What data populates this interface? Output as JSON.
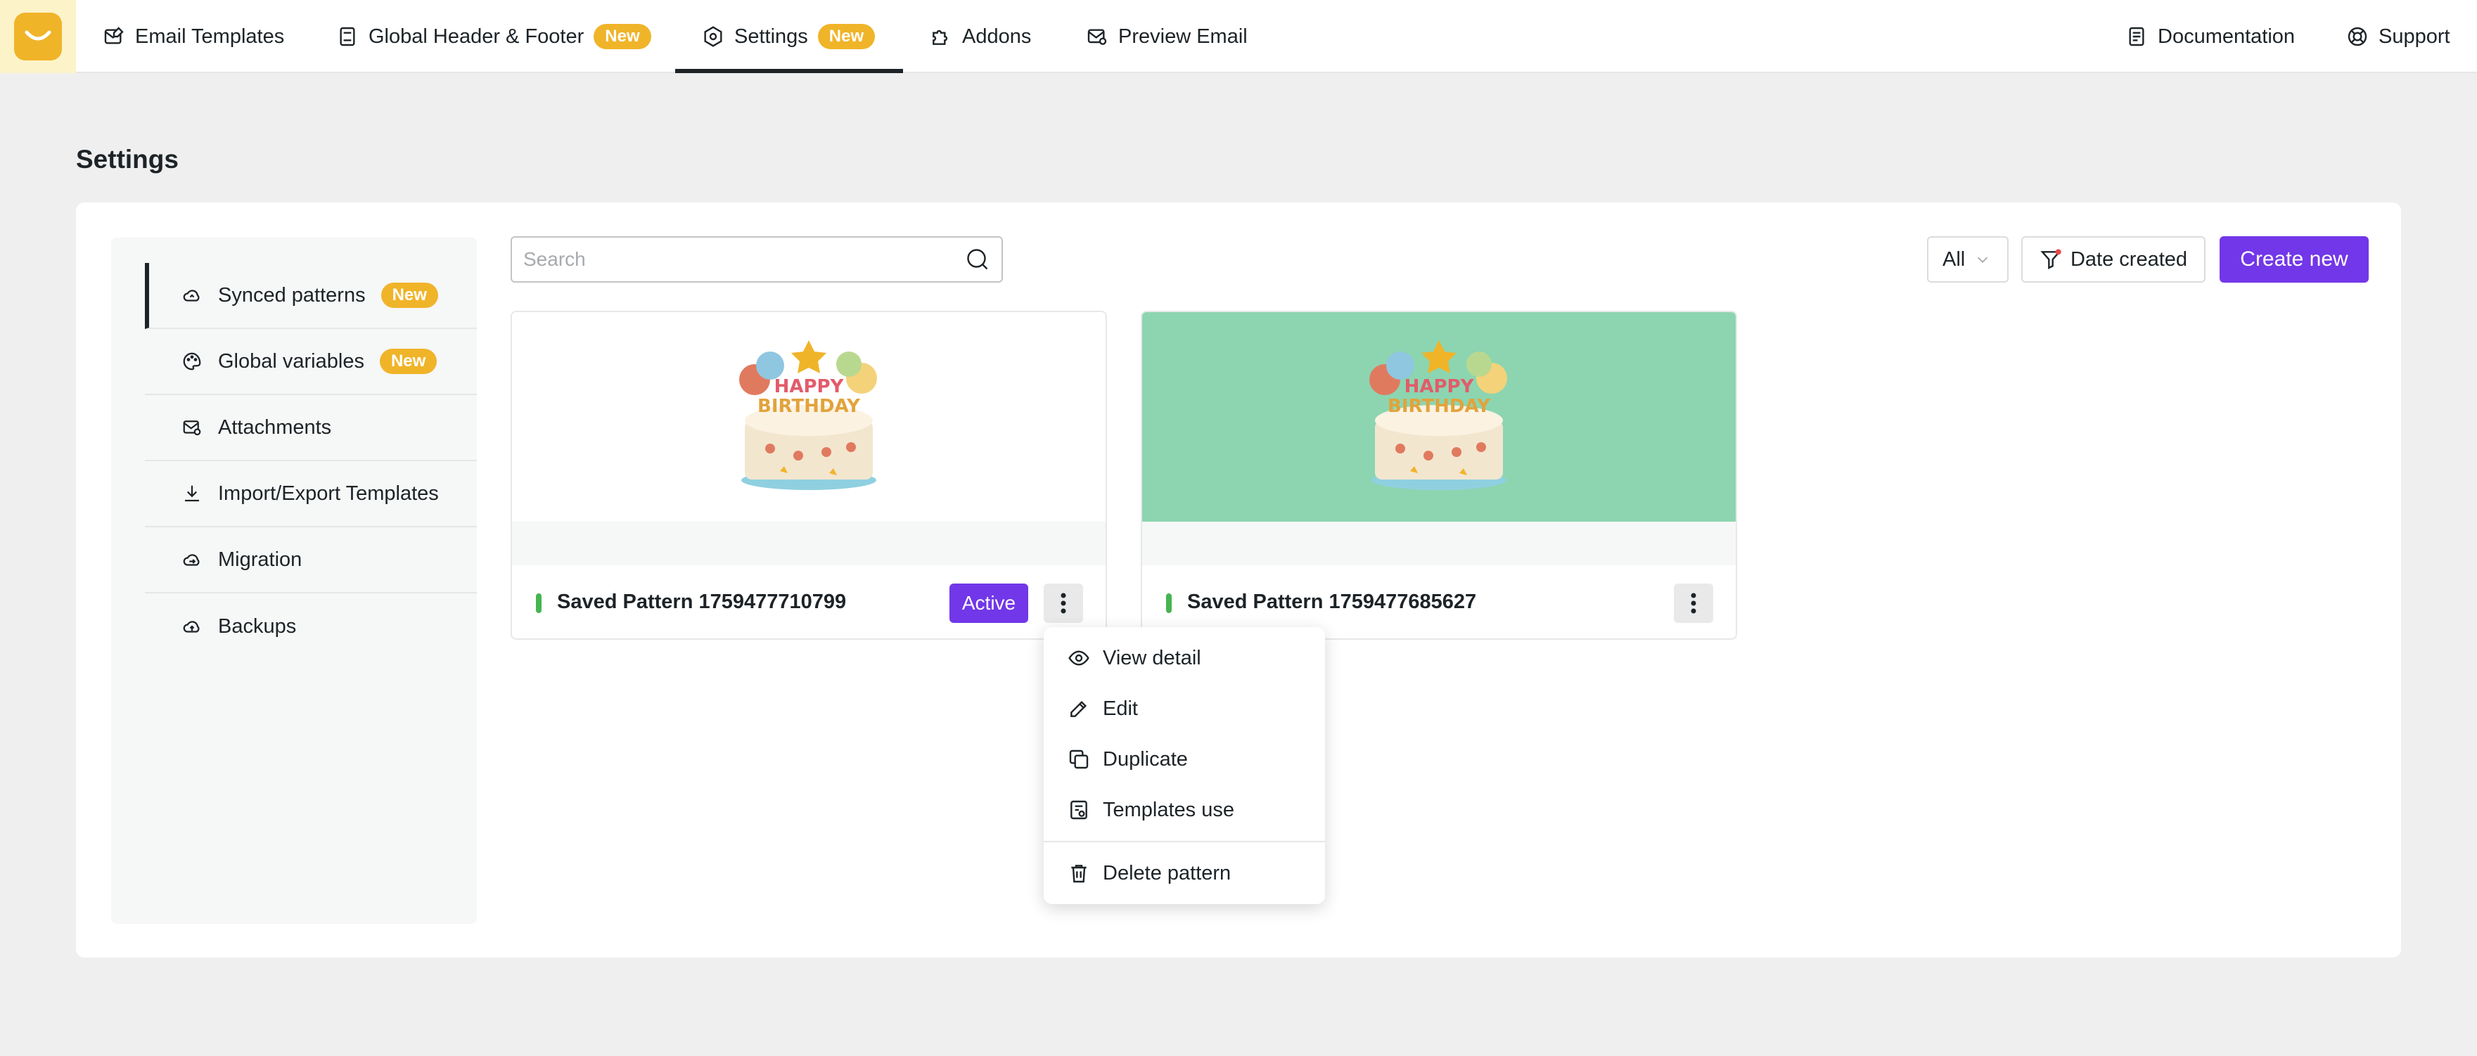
{
  "topnav": {
    "items": [
      {
        "label": "Email Templates",
        "icon": "email-edit-icon"
      },
      {
        "label": "Global Header & Footer",
        "icon": "document-icon",
        "badge": "New"
      },
      {
        "label": "Settings",
        "icon": "settings-hex-icon",
        "badge": "New",
        "active": true
      },
      {
        "label": "Addons",
        "icon": "puzzle-icon"
      },
      {
        "label": "Preview Email",
        "icon": "email-preview-icon"
      }
    ],
    "right": [
      {
        "label": "Documentation",
        "icon": "document-icon"
      },
      {
        "label": "Support",
        "icon": "lifebuoy-icon"
      }
    ]
  },
  "page": {
    "title": "Settings"
  },
  "sidebar": {
    "items": [
      {
        "label": "Synced patterns",
        "badge": "New",
        "icon": "cloud-sync-icon",
        "active": true
      },
      {
        "label": "Global variables",
        "badge": "New",
        "icon": "palette-icon"
      },
      {
        "label": "Attachments",
        "icon": "attachment-icon"
      },
      {
        "label": "Import/Export Templates",
        "icon": "download-icon"
      },
      {
        "label": "Migration",
        "icon": "cloud-migrate-icon"
      },
      {
        "label": "Backups",
        "icon": "cloud-upload-icon"
      }
    ]
  },
  "toolbar": {
    "search_placeholder": "Search",
    "filter_value": "All",
    "sort_label": "Date created",
    "create_label": "Create new"
  },
  "patterns": [
    {
      "name": "Saved Pattern 1759477710799",
      "status": "Active",
      "preview_bg": "#ffffff"
    },
    {
      "name": "Saved Pattern 1759477685627",
      "status": "",
      "preview_bg": "#8cd5b0"
    }
  ],
  "menu": {
    "items": [
      {
        "label": "View detail",
        "icon": "eye-icon"
      },
      {
        "label": "Edit",
        "icon": "pencil-icon"
      },
      {
        "label": "Duplicate",
        "icon": "duplicate-icon"
      },
      {
        "label": "Templates use",
        "icon": "templates-icon"
      },
      {
        "label": "Delete pattern",
        "icon": "trash-icon"
      }
    ]
  },
  "colors": {
    "accent": "#7237e8",
    "badge": "#f0b429",
    "status_active": "#46b450"
  }
}
